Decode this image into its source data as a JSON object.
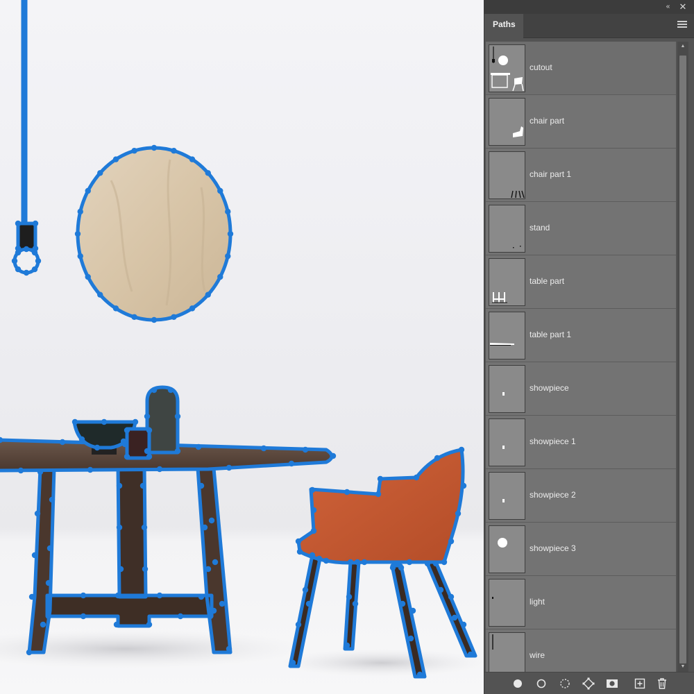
{
  "panel": {
    "tab_label": "Paths",
    "top_controls": {
      "collapse_glyph": "«",
      "close_glyph": "✕"
    },
    "paths": [
      {
        "name": "cutout",
        "thumb": "cutout-thumbnail"
      },
      {
        "name": "chair part",
        "thumb": "chair-part-thumbnail"
      },
      {
        "name": "chair part 1",
        "thumb": "chair-legs-thumbnail"
      },
      {
        "name": "stand",
        "thumb": "stand-thumbnail"
      },
      {
        "name": "table part",
        "thumb": "table-legs-thumbnail"
      },
      {
        "name": "table part 1",
        "thumb": "table-top-thumbnail"
      },
      {
        "name": "showpiece",
        "thumb": "showpiece-thumbnail"
      },
      {
        "name": "showpiece 1",
        "thumb": "showpiece-thumbnail"
      },
      {
        "name": "showpiece 2",
        "thumb": "showpiece-thumbnail"
      },
      {
        "name": "showpiece 3",
        "thumb": "circle-thumbnail"
      },
      {
        "name": "light",
        "thumb": "light-thumbnail"
      },
      {
        "name": "wire",
        "thumb": "wire-thumbnail"
      }
    ],
    "bottom_buttons": [
      {
        "icon": "fill-path-icon"
      },
      {
        "icon": "stroke-path-icon"
      },
      {
        "icon": "load-as-selection-icon"
      },
      {
        "icon": "make-work-path-icon"
      },
      {
        "icon": "add-mask-icon"
      },
      {
        "icon": "new-path-icon"
      },
      {
        "icon": "delete-path-icon"
      }
    ]
  },
  "colors": {
    "path_stroke": "#1f7ad8",
    "panel_bg": "#535353",
    "row_bg": "#737373",
    "chair_fabric": "#c4572e",
    "wood_mirror": "#dcc9ad",
    "table_wood": "#5a4539"
  }
}
